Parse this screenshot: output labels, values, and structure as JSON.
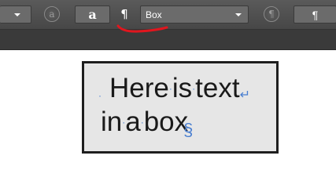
{
  "toolbar": {
    "circle_a_glyph": "a",
    "char_button_label": "a",
    "pilcrow_label": "¶",
    "paragraph_style_value": "Box",
    "circle_pilcrow_glyph": "¶",
    "pilcrow_button_label": "¶"
  },
  "textbox": {
    "line1": [
      "Here",
      "is",
      "text"
    ],
    "line2": [
      "in",
      "a",
      "box"
    ],
    "space_marker": "·",
    "line_break_marker": "↵",
    "end_marker": "§"
  },
  "colors": {
    "toolbar_bg": "#4f4f4f",
    "button_bg": "#6b6b6b",
    "annotation_red": "#e0161e",
    "invisibles_blue": "#4a7fd0",
    "textbox_bg": "#e6e6e6"
  }
}
